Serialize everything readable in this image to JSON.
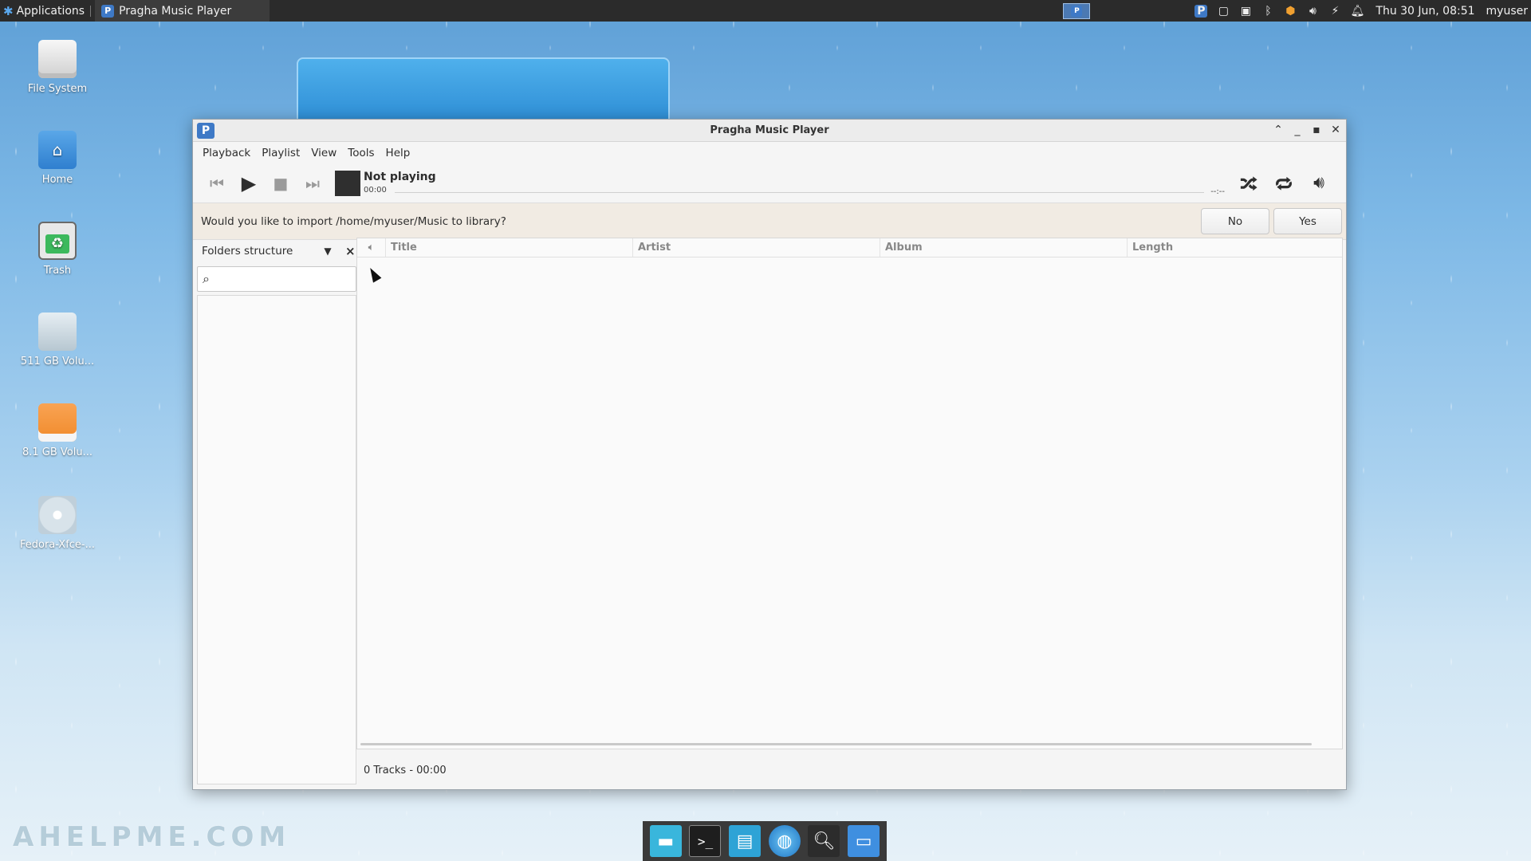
{
  "top_panel": {
    "applications_label": "Applications",
    "task_label": "Pragha Music Player",
    "clock": "Thu 30 Jun, 08:51",
    "user": "myuser"
  },
  "desktop": {
    "icons": [
      {
        "label": "File System",
        "icon": "drive-icon"
      },
      {
        "label": "Home",
        "icon": "home-folder-icon"
      },
      {
        "label": "Trash",
        "icon": "trash-icon"
      },
      {
        "label": "511 GB Volu...",
        "icon": "drive-icon"
      },
      {
        "label": "8.1 GB Volu...",
        "icon": "usb-drive-icon"
      },
      {
        "label": "Fedora-Xfce-...",
        "icon": "disc-icon"
      }
    ],
    "watermark": "AHELPME.COM"
  },
  "window": {
    "title": "Pragha Music Player",
    "menu": [
      "Playback",
      "Playlist",
      "View",
      "Tools",
      "Help"
    ],
    "now_playing": "Not playing",
    "elapsed": "00:00",
    "duration": "--:--",
    "progress": 0,
    "import_prompt": "Would you like to import /home/myuser/Music to library?",
    "no_label": "No",
    "yes_label": "Yes",
    "sidebar_mode": "Folders structure",
    "columns": [
      "Title",
      "Artist",
      "Album",
      "Length"
    ],
    "status": "0 Tracks - 00:00"
  },
  "colors": {
    "panel": "#2b2b2b",
    "accent": "#3e79c6",
    "infobar": "#f1ebe3"
  }
}
